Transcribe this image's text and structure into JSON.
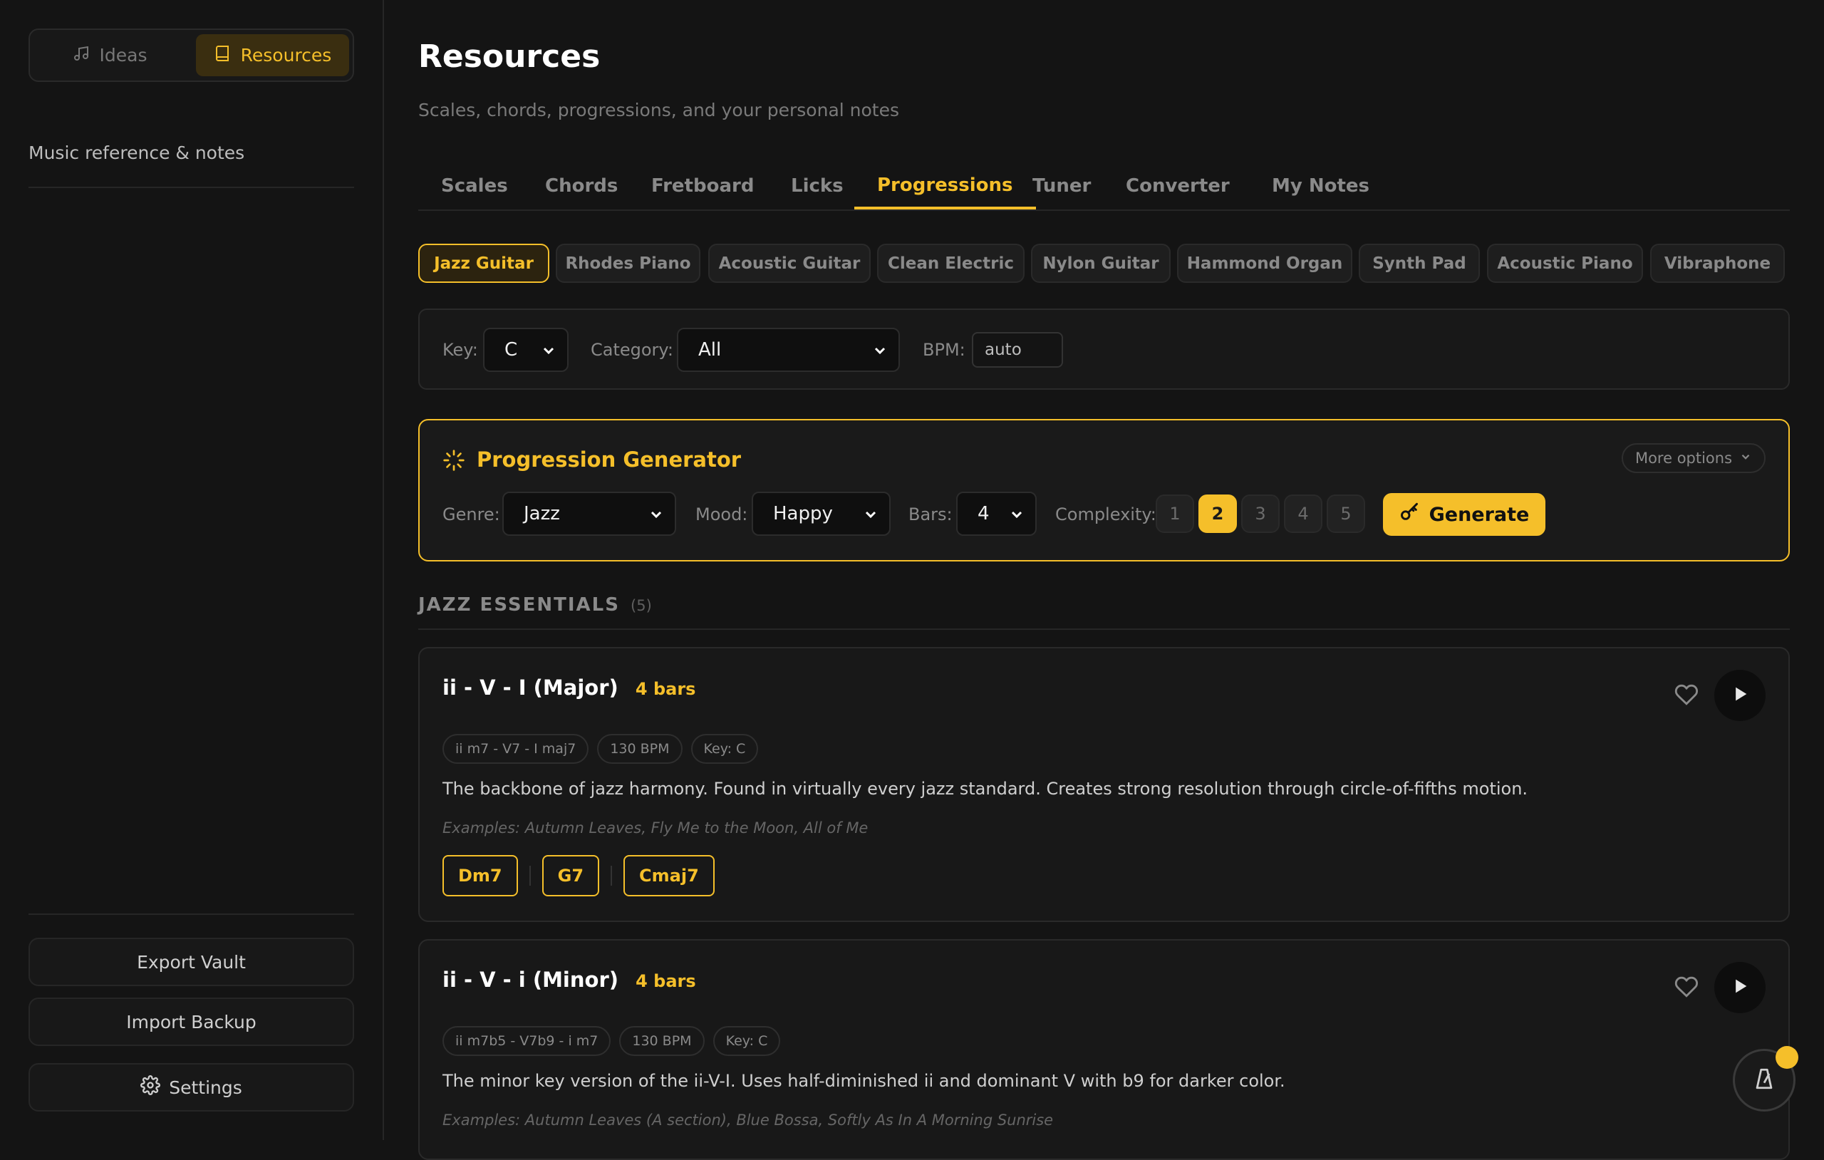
{
  "sidebar": {
    "mode_ideas": "Ideas",
    "mode_resources": "Resources",
    "subtitle": "Music reference & notes",
    "export_label": "Export Vault",
    "import_label": "Import Backup",
    "settings_label": "Settings"
  },
  "header": {
    "title": "Resources",
    "subtitle": "Scales, chords, progressions, and your personal notes"
  },
  "tabs": [
    "Scales",
    "Chords",
    "Fretboard",
    "Licks",
    "Progressions",
    "Tuner",
    "Converter",
    "My Notes"
  ],
  "active_tab": "Progressions",
  "instruments": [
    "Jazz Guitar",
    "Rhodes Piano",
    "Acoustic Guitar",
    "Clean Electric",
    "Nylon Guitar",
    "Hammond Organ",
    "Synth Pad",
    "Acoustic Piano",
    "Vibraphone"
  ],
  "active_instrument": "Jazz Guitar",
  "filters": {
    "key_label": "Key:",
    "key_value": "C",
    "category_label": "Category:",
    "category_value": "All",
    "bpm_label": "BPM:",
    "bpm_placeholder": "auto"
  },
  "generator": {
    "title": "Progression Generator",
    "more_options": "More options",
    "genre_label": "Genre:",
    "genre_value": "Jazz",
    "mood_label": "Mood:",
    "mood_value": "Happy",
    "bars_label": "Bars:",
    "bars_value": "4",
    "complexity_label": "Complexity:",
    "complexity_levels": [
      "1",
      "2",
      "3",
      "4",
      "5"
    ],
    "complexity_selected": "2",
    "generate_label": "Generate"
  },
  "section": {
    "title": "JAZZ ESSENTIALS",
    "count": "(5)"
  },
  "progressions": [
    {
      "name": "ii - V - I (Major)",
      "bars": "4 bars",
      "tags": [
        "ii m7 - V7 - I maj7",
        "130 BPM",
        "Key: C"
      ],
      "description": "The backbone of jazz harmony. Found in virtually every jazz standard. Creates strong resolution through circle-of-fifths motion.",
      "examples": "Examples: Autumn Leaves, Fly Me to the Moon, All of Me",
      "chords": [
        "Dm7",
        "G7",
        "Cmaj7"
      ]
    },
    {
      "name": "ii - V - i (Minor)",
      "bars": "4 bars",
      "tags": [
        "ii m7b5 - V7b9 - i m7",
        "130 BPM",
        "Key: C"
      ],
      "description": "The minor key version of the ii-V-I. Uses half-diminished ii and dominant V with b9 for darker color.",
      "examples": "Examples: Autumn Leaves (A section), Blue Bossa, Softly As In A Morning Sunrise"
    }
  ],
  "colors": {
    "accent": "#f5bf2a",
    "background": "#141414",
    "panel": "#181818"
  }
}
